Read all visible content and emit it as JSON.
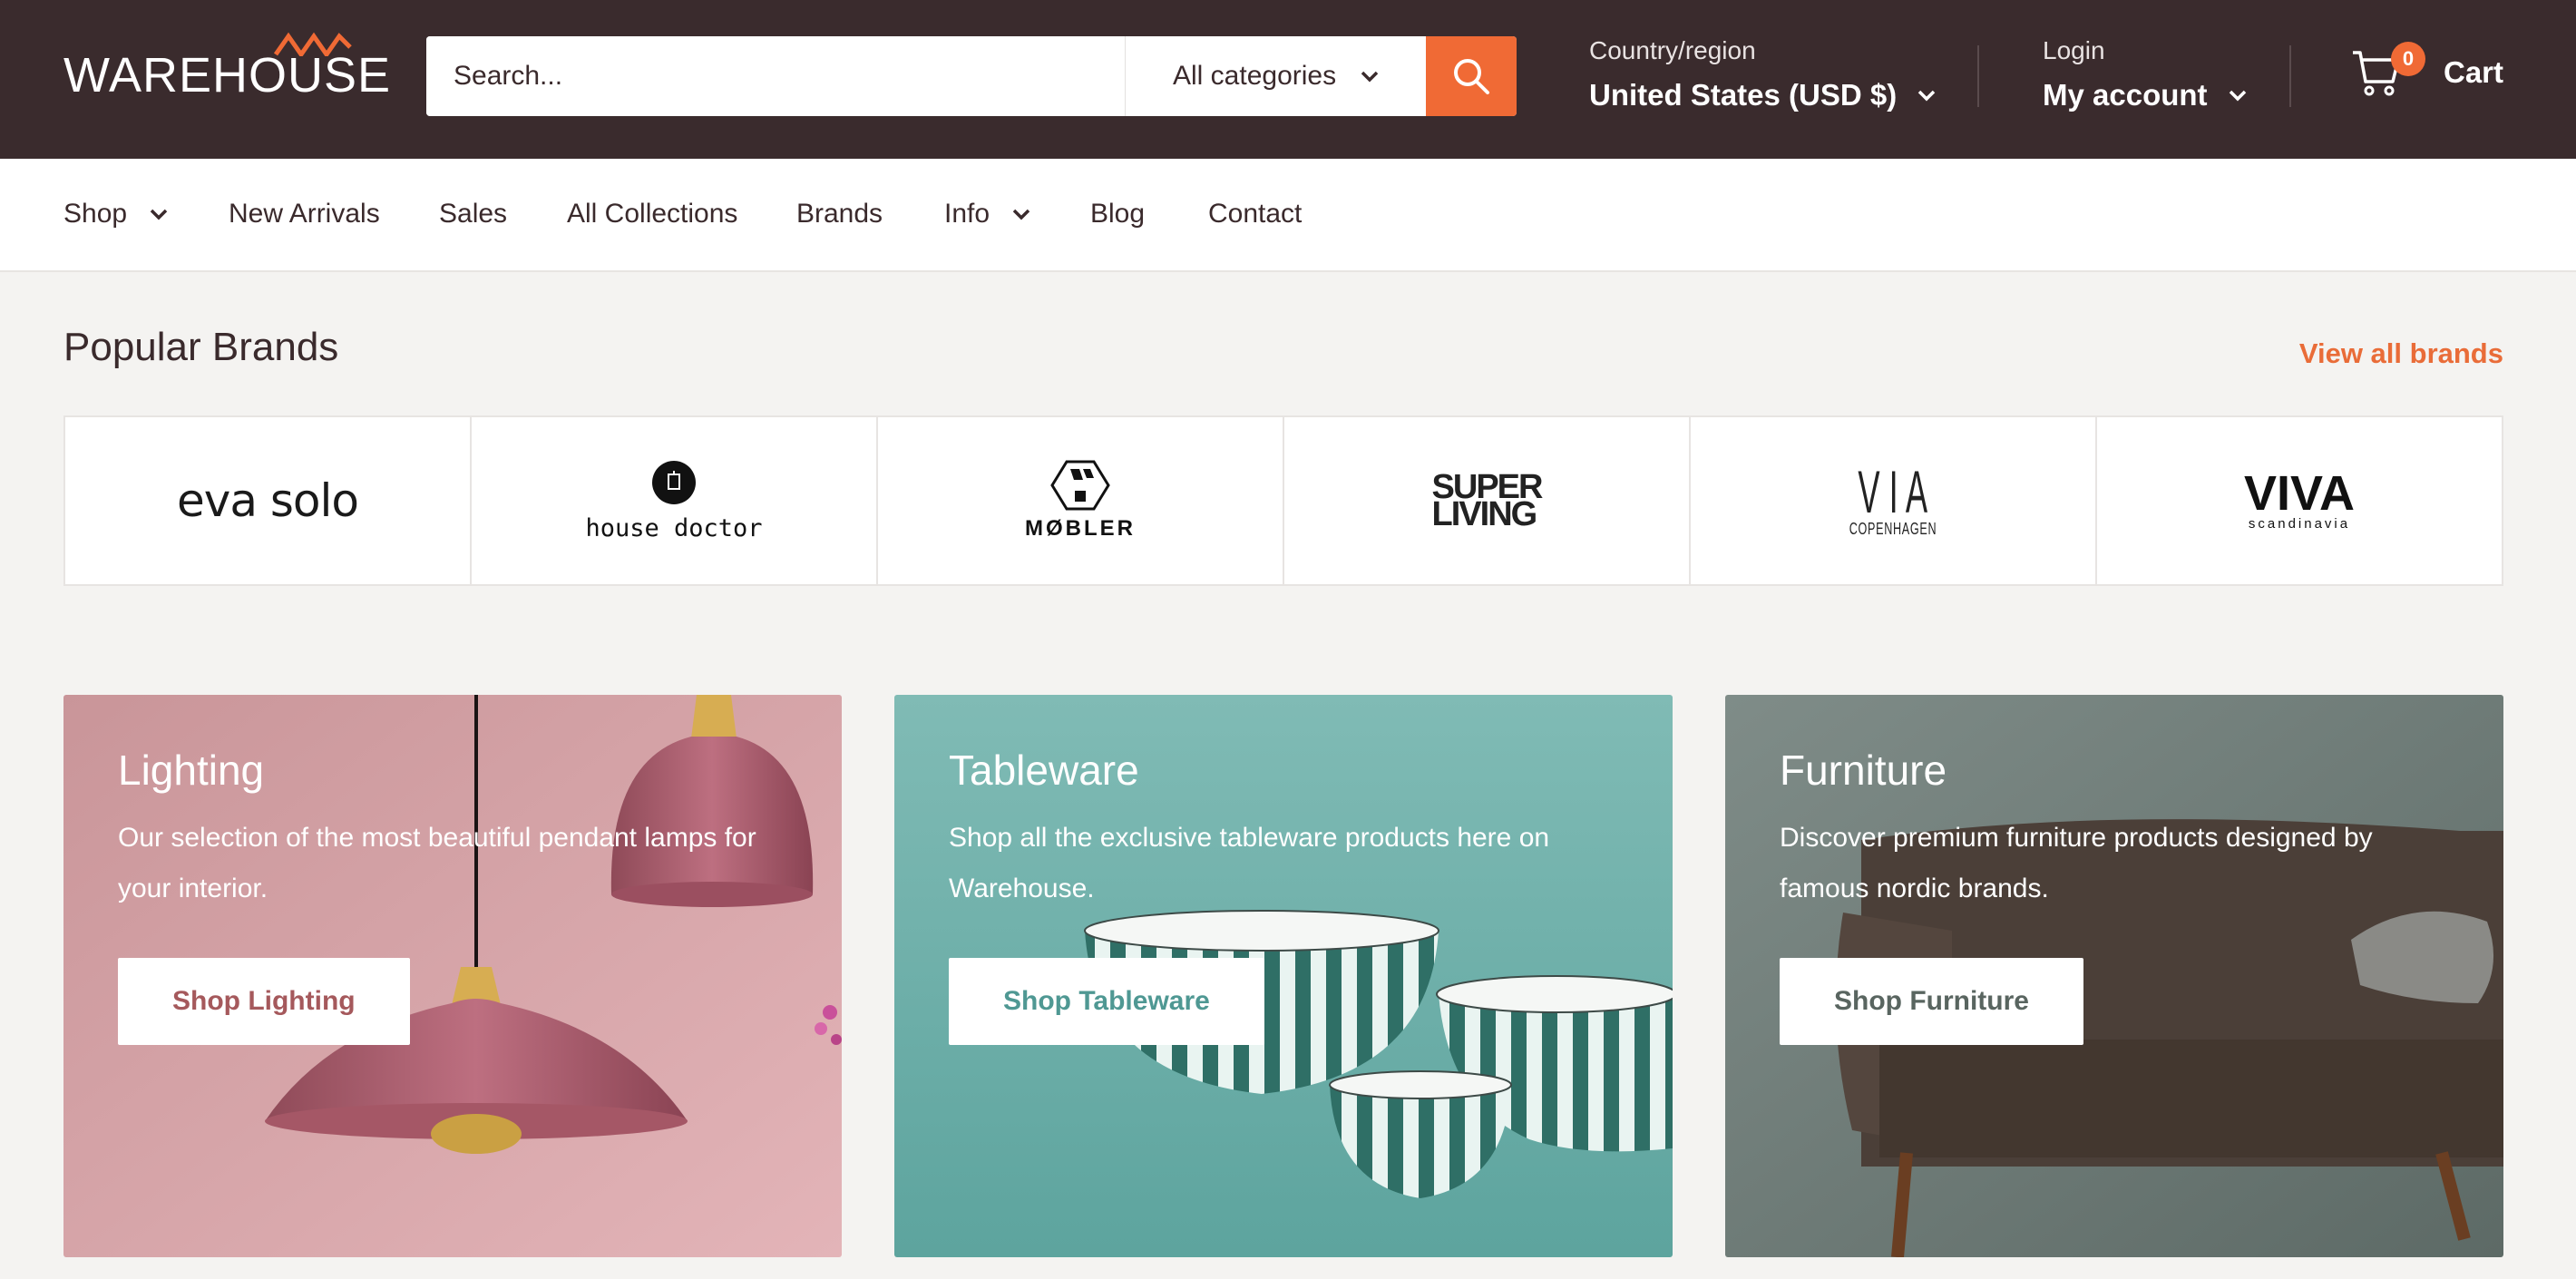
{
  "header": {
    "logo_text": "WAREHOUSE",
    "search_placeholder": "Search...",
    "category_label": "All categories",
    "country_small": "Country/region",
    "country_value": "United States (USD $)",
    "login_small": "Login",
    "account_label": "My account",
    "cart_count": "0",
    "cart_label": "Cart"
  },
  "nav": {
    "items": [
      "Shop",
      "New Arrivals",
      "Sales",
      "All Collections",
      "Brands",
      "Info",
      "Blog",
      "Contact"
    ]
  },
  "brands": {
    "title": "Popular Brands",
    "view_all": "View all brands",
    "logos": [
      "eva solo",
      "house doctor",
      "MØBLER",
      "SUPER LIVING",
      "VIA COPENHAGEN",
      "VIVA scandinavia"
    ],
    "logo_sub": {
      "via_big": "V I A",
      "via_small": "COPENHAGEN",
      "viva_big": "VIVA",
      "viva_small": "scandinavia",
      "super_1": "SUPER",
      "super_2": "LIVING"
    }
  },
  "cards": [
    {
      "title": "Lighting",
      "desc": "Our selection of the most beautiful pendant lamps for your interior.",
      "button": "Shop Lighting",
      "bg": "#d9a7aa",
      "btn_color": "#a5595c"
    },
    {
      "title": "Tableware",
      "desc": "Shop all the exclusive tableware products here on Warehouse.",
      "button": "Shop Tableware",
      "bg": "#6fb3ad",
      "btn_color": "#4f9893"
    },
    {
      "title": "Furniture",
      "desc": "Discover premium furniture products designed by famous nordic brands.",
      "button": "Shop Furniture",
      "bg": "#76837f",
      "btn_color": "#596560"
    }
  ],
  "colors": {
    "header_bg": "#3a2b2d",
    "accent": "#f06a35",
    "page_bg": "#f4f3f1"
  }
}
